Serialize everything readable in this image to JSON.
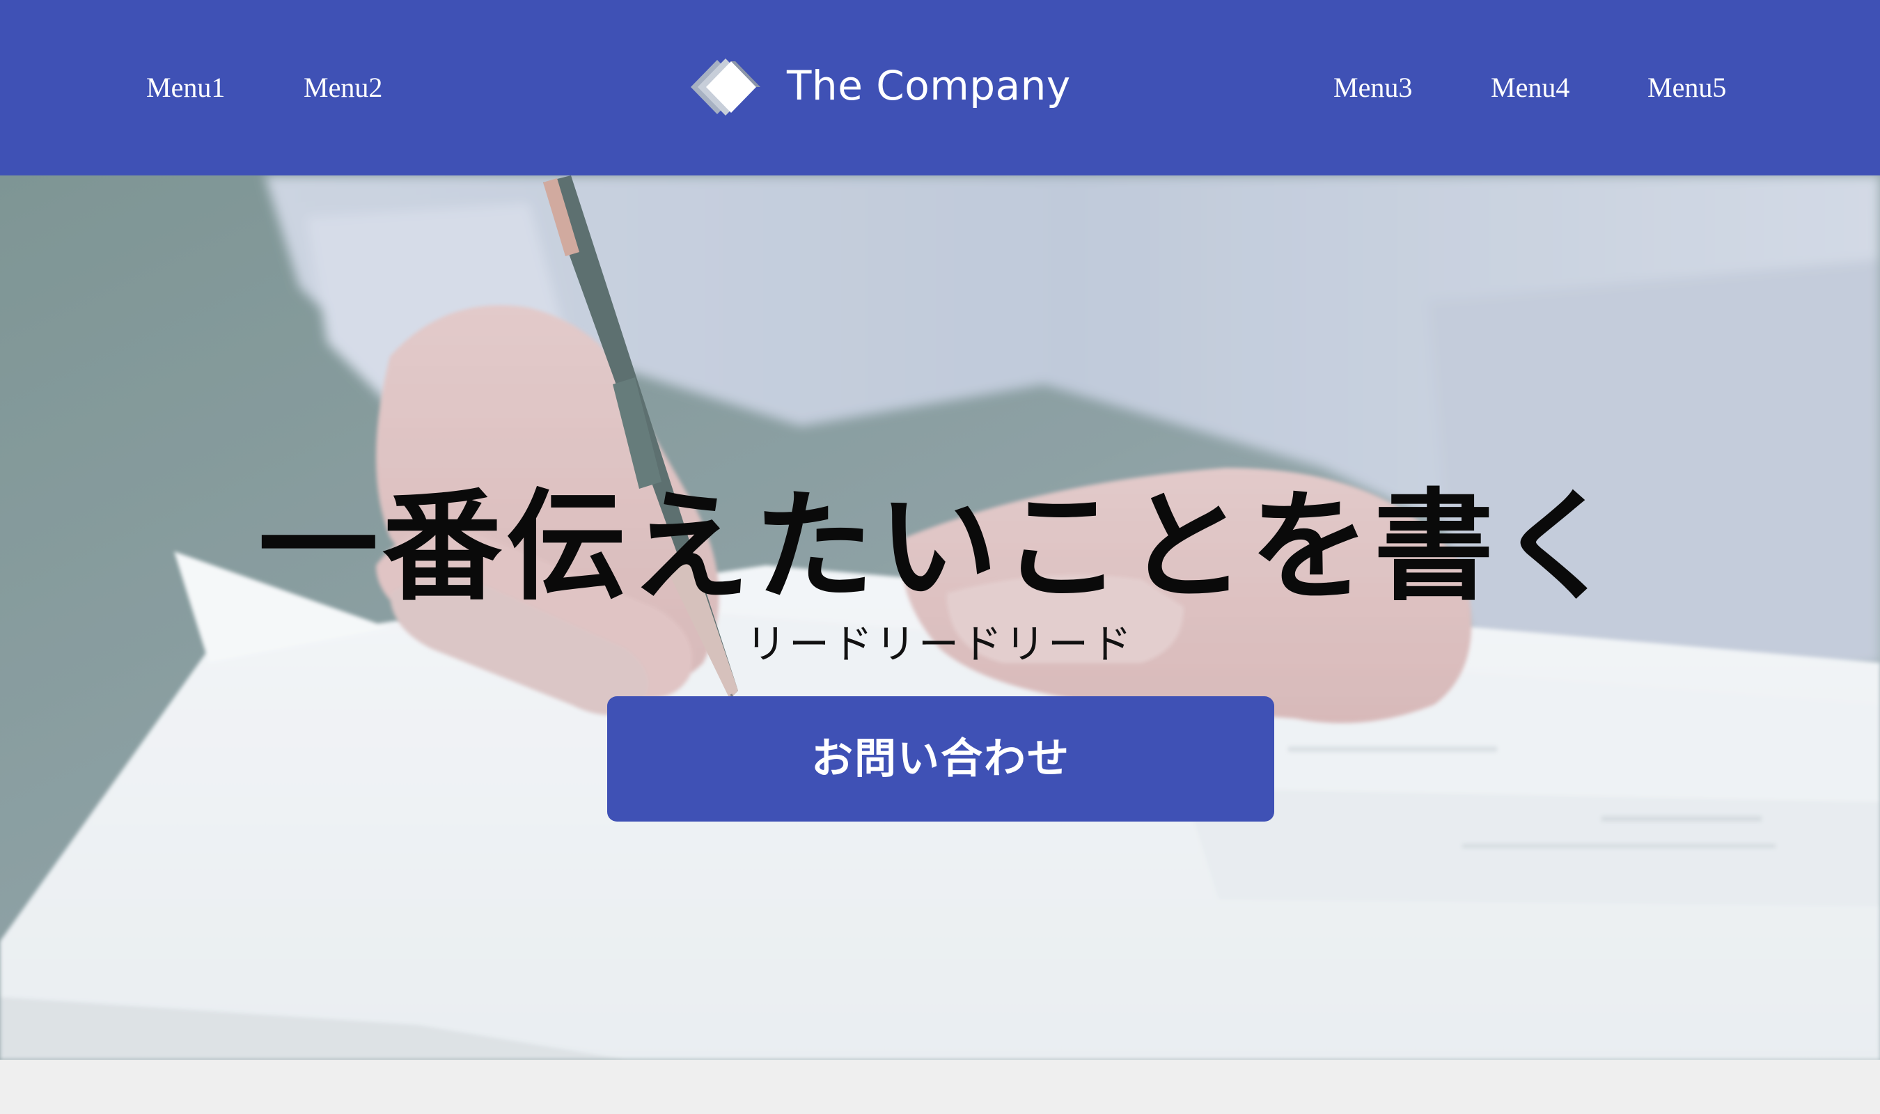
{
  "header": {
    "logo_text": "The Company",
    "logo_icon": "diamond-logo-icon",
    "menu_left": [
      {
        "label": "Menu1"
      },
      {
        "label": "Menu2"
      }
    ],
    "menu_right": [
      {
        "label": "Menu3"
      },
      {
        "label": "Menu4"
      },
      {
        "label": "Menu5"
      }
    ]
  },
  "hero": {
    "background_image": "hand-writing-document-photo",
    "title": "一番伝えたいことを書く",
    "lead": "リードリードリード",
    "cta_label": "お問い合わせ"
  },
  "colors": {
    "brand": "#3f51b5",
    "page_background": "#efefef",
    "text_on_brand": "#ffffff"
  }
}
